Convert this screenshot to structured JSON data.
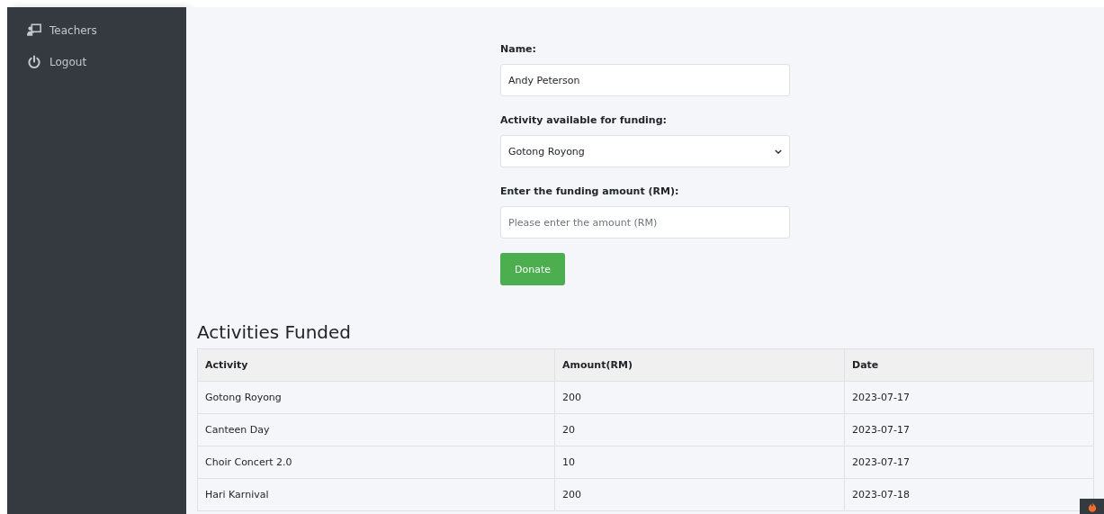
{
  "sidebar": {
    "items": [
      {
        "kind": "teachers",
        "label": "Teachers"
      },
      {
        "kind": "logout",
        "label": "Logout"
      }
    ]
  },
  "form": {
    "name_label": "Name:",
    "name_value": "Andy Peterson",
    "activity_label": "Activity available for funding:",
    "activity_value": "Gotong Royong",
    "amount_label": "Enter the funding amount (RM):",
    "amount_placeholder": "Please enter the amount (RM)",
    "submit": "Donate"
  },
  "table": {
    "title": "Activities Funded",
    "columns": [
      "Activity",
      "Amount(RM)",
      "Date"
    ],
    "rows": [
      [
        "Gotong Royong",
        "200",
        "2023-07-17"
      ],
      [
        "Canteen Day",
        "20",
        "2023-07-17"
      ],
      [
        "Choir Concert 2.0",
        "10",
        "2023-07-17"
      ],
      [
        "Hari Karnival",
        "200",
        "2023-07-18"
      ]
    ]
  }
}
